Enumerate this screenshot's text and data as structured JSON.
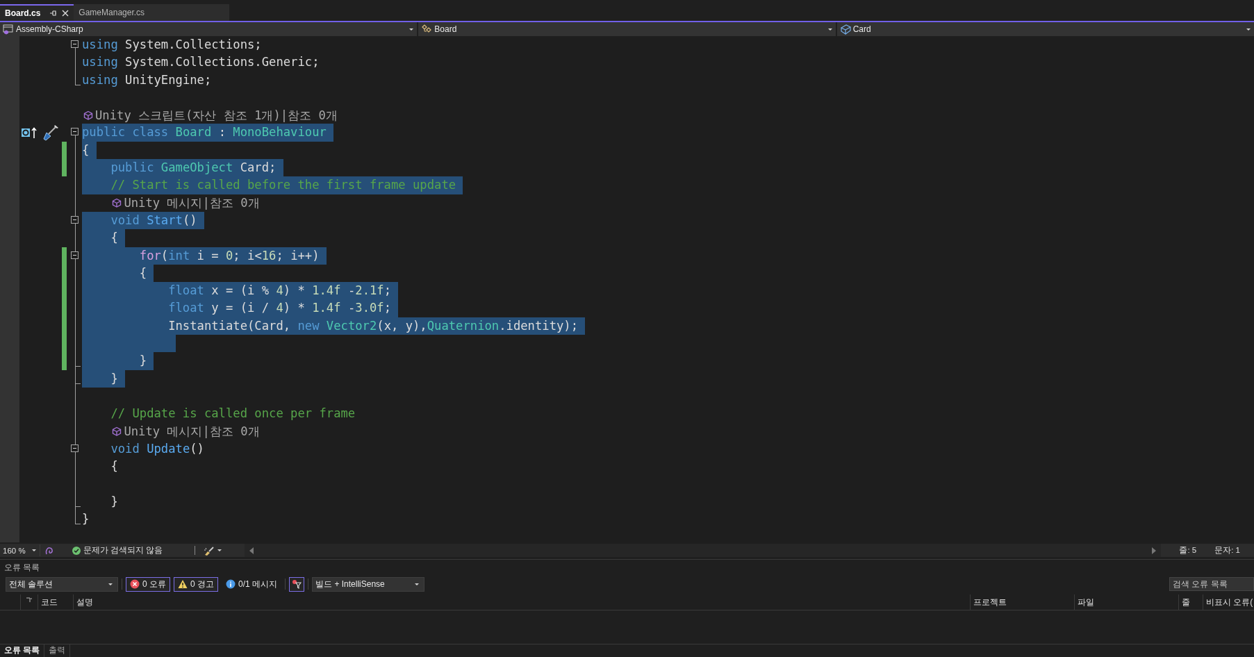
{
  "tabs": [
    {
      "label": "Board.cs",
      "selected": true
    },
    {
      "label": "GameManager.cs",
      "selected": false
    }
  ],
  "navigation_bar": {
    "project": "Assembly-CSharp",
    "class": "Board",
    "member": "Card"
  },
  "editor": {
    "lines": [
      {
        "kind": "code",
        "collapsible": true,
        "tokens": [
          {
            "text": "using",
            "kind": "keyword"
          },
          {
            "text": " System.Collections;",
            "kind": "plain"
          }
        ]
      },
      {
        "kind": "code",
        "tokens": [
          {
            "text": "using",
            "kind": "keyword"
          },
          {
            "text": " System.Collections.Generic;",
            "kind": "plain"
          }
        ]
      },
      {
        "kind": "code",
        "block_end": true,
        "tokens": [
          {
            "text": "using",
            "kind": "keyword"
          },
          {
            "text": " UnityEngine;",
            "kind": "plain"
          }
        ]
      },
      {
        "kind": "code"
      },
      {
        "kind": "codelens",
        "text": "Unity 스크립트(자산 참조 1개)|참조 0개"
      },
      {
        "kind": "code",
        "collapsible": true,
        "selected": true,
        "margin_glyphs": true,
        "tokens": [
          {
            "text": "public class",
            "kind": "keyword"
          },
          {
            "text": " Board",
            "kind": "type"
          },
          {
            "text": " : ",
            "kind": "plain"
          },
          {
            "text": "MonoBehaviour",
            "kind": "type"
          }
        ]
      },
      {
        "kind": "code",
        "selected": true,
        "changed": true,
        "tokens": [
          {
            "text": "{",
            "kind": "plain"
          }
        ]
      },
      {
        "kind": "code",
        "selected": true,
        "changed": true,
        "tokens": [
          {
            "text": "    public",
            "kind": "keyword"
          },
          {
            "text": " GameObject",
            "kind": "type"
          },
          {
            "text": " Card;",
            "kind": "plain"
          }
        ]
      },
      {
        "kind": "code",
        "selected": true,
        "tokens": [
          {
            "text": "    // Start is called before the first frame update",
            "kind": "comment"
          }
        ]
      },
      {
        "kind": "codelens",
        "nested": true,
        "text": "Unity 메시지|참조 0개"
      },
      {
        "kind": "code",
        "collapsible": true,
        "selected": true,
        "tokens": [
          {
            "text": "    void",
            "kind": "keyword"
          },
          {
            "text": " Start",
            "kind": "method"
          },
          {
            "text": "()",
            "kind": "plain"
          }
        ]
      },
      {
        "kind": "code",
        "selected": true,
        "tokens": [
          {
            "text": "    {",
            "kind": "plain"
          }
        ]
      },
      {
        "kind": "code",
        "collapsible": true,
        "selected": true,
        "changed": true,
        "tokens": [
          {
            "text": "        for",
            "kind": "control"
          },
          {
            "text": "(",
            "kind": "plain"
          },
          {
            "text": "int",
            "kind": "keyword"
          },
          {
            "text": " i = ",
            "kind": "plain"
          },
          {
            "text": "0",
            "kind": "number"
          },
          {
            "text": "; i<",
            "kind": "plain"
          },
          {
            "text": "16",
            "kind": "number"
          },
          {
            "text": "; i++)",
            "kind": "plain"
          }
        ]
      },
      {
        "kind": "code",
        "selected": true,
        "changed": true,
        "tokens": [
          {
            "text": "        {",
            "kind": "plain"
          }
        ]
      },
      {
        "kind": "code",
        "selected": true,
        "changed": true,
        "tokens": [
          {
            "text": "            float",
            "kind": "keyword"
          },
          {
            "text": " x = (i % ",
            "kind": "plain"
          },
          {
            "text": "4",
            "kind": "number"
          },
          {
            "text": ") * ",
            "kind": "plain"
          },
          {
            "text": "1.4f",
            "kind": "number"
          },
          {
            "text": " -",
            "kind": "plain"
          },
          {
            "text": "2.1f",
            "kind": "number"
          },
          {
            "text": ";",
            "kind": "plain"
          }
        ]
      },
      {
        "kind": "code",
        "selected": true,
        "changed": true,
        "tokens": [
          {
            "text": "            float",
            "kind": "keyword"
          },
          {
            "text": " y = (i / ",
            "kind": "plain"
          },
          {
            "text": "4",
            "kind": "number"
          },
          {
            "text": ") * ",
            "kind": "plain"
          },
          {
            "text": "1.4f",
            "kind": "number"
          },
          {
            "text": " -",
            "kind": "plain"
          },
          {
            "text": "3.0f",
            "kind": "number"
          },
          {
            "text": ";",
            "kind": "plain"
          }
        ]
      },
      {
        "kind": "code",
        "selected": true,
        "changed": true,
        "tokens": [
          {
            "text": "            Instantiate(Card, ",
            "kind": "plain"
          },
          {
            "text": "new",
            "kind": "keyword"
          },
          {
            "text": " Vector2",
            "kind": "type"
          },
          {
            "text": "(x, y),",
            "kind": "plain"
          },
          {
            "text": "Quaternion",
            "kind": "type"
          },
          {
            "text": ".identity);",
            "kind": "plain"
          }
        ]
      },
      {
        "kind": "code",
        "selected": true,
        "changed": true
      },
      {
        "kind": "code",
        "block_end": true,
        "selected": true,
        "changed": true,
        "tokens": [
          {
            "text": "        }",
            "kind": "plain"
          }
        ]
      },
      {
        "kind": "code",
        "block_end": true,
        "selected": true,
        "tokens": [
          {
            "text": "    }",
            "kind": "plain"
          }
        ]
      },
      {
        "kind": "code"
      },
      {
        "kind": "code",
        "tokens": [
          {
            "text": "    // Update is called once per frame",
            "kind": "comment"
          }
        ]
      },
      {
        "kind": "codelens",
        "nested": true,
        "text": "Unity 메시지|참조 0개"
      },
      {
        "kind": "code",
        "collapsible": true,
        "tokens": [
          {
            "text": "    void",
            "kind": "keyword"
          },
          {
            "text": " Update",
            "kind": "method"
          },
          {
            "text": "()",
            "kind": "plain"
          }
        ]
      },
      {
        "kind": "code",
        "tokens": [
          {
            "text": "    {",
            "kind": "plain"
          }
        ]
      },
      {
        "kind": "code"
      },
      {
        "kind": "code",
        "block_end": true,
        "tokens": [
          {
            "text": "    }",
            "kind": "plain"
          }
        ]
      },
      {
        "kind": "code",
        "block_end": true,
        "tokens": [
          {
            "text": "}",
            "kind": "plain"
          }
        ]
      }
    ]
  },
  "status_bar": {
    "zoom": "160 %",
    "issues": "문제가 검색되지 않음",
    "line": "줄: 5",
    "column": "문자: 1"
  },
  "error_list": {
    "title": "오류 목록",
    "scope": "전체 솔루션",
    "filters": [
      {
        "kind": "error",
        "label": "0 오류",
        "selected": true
      },
      {
        "kind": "warning",
        "label": "0 경고",
        "selected": true
      },
      {
        "kind": "message",
        "label": "0/1 메시지",
        "selected": false
      }
    ],
    "filter_toggle": {
      "selected": true
    },
    "source": "빌드 + IntelliSense",
    "search": {
      "placeholder": "검색 오류 목록"
    },
    "columns": [
      "코드",
      "설명",
      "프로젝트",
      "파일",
      "줄",
      "비표시 오류("
    ]
  },
  "bottom_tabs": [
    {
      "label": "오류 목록",
      "selected": true
    },
    {
      "label": "출력",
      "selected": false
    }
  ]
}
